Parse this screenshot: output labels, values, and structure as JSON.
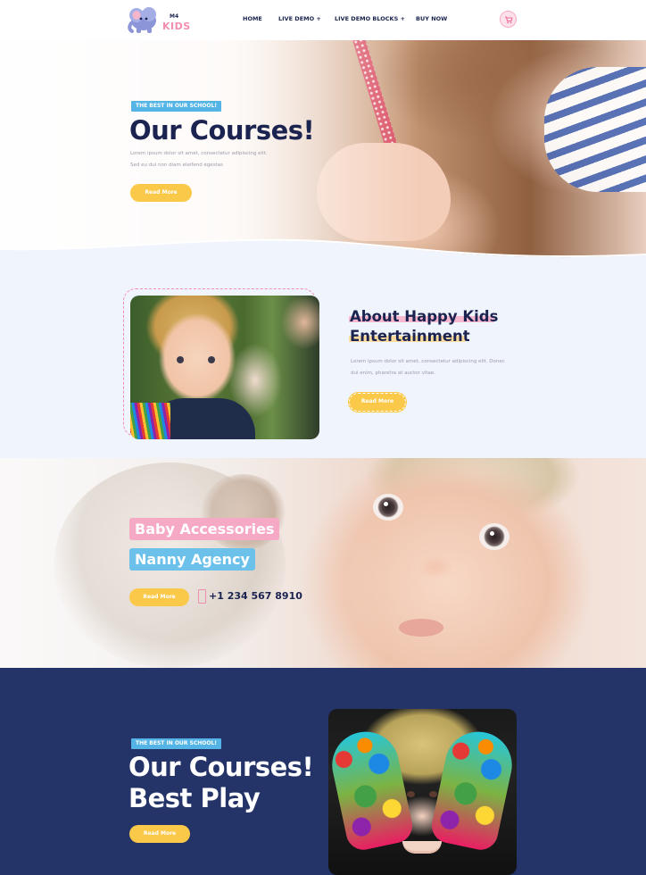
{
  "header": {
    "logo": {
      "top": "M4",
      "bottom": "KIDS"
    },
    "nav": [
      "HOME",
      "LIVE DEMO +",
      "LIVE DEMO BLOCKS +",
      "BUY NOW"
    ],
    "cart_icon": "cart-icon"
  },
  "hero": {
    "tag": "THE BEST IN OUR SCHOOL!",
    "title": "Our Courses!",
    "text_lines": [
      "Lorem ipsum dolor sit amet, consectetur adipiscing elit.",
      "Sed eu dui non diam eleifend egestas"
    ],
    "button": "Read More"
  },
  "about": {
    "title_lines": [
      "About Happy Kids",
      "Entertainment"
    ],
    "text_lines": [
      "Lorem ipsum dolor sit amet, consectetur adipiscing elit. Donec",
      "dui enim, pharetra at auctor vitae."
    ],
    "button": "Read More"
  },
  "banner": {
    "pill_1": "Baby Accessories",
    "pill_2": "Nanny Agency",
    "button": "Read More",
    "phone_icon": "phone-icon",
    "phone": "+1 234 567 8910"
  },
  "courses": {
    "tag": "THE BEST IN OUR SCHOOL!",
    "title_lines": [
      "Our Courses!",
      "Best Play"
    ],
    "button": "Read More"
  },
  "colors": {
    "navy": "#1b2350",
    "pink": "#f28cb1",
    "blue": "#54b4e5",
    "yellow": "#fbc94a",
    "dark_bg": "#253468",
    "about_bg": "#f0f4fc"
  }
}
